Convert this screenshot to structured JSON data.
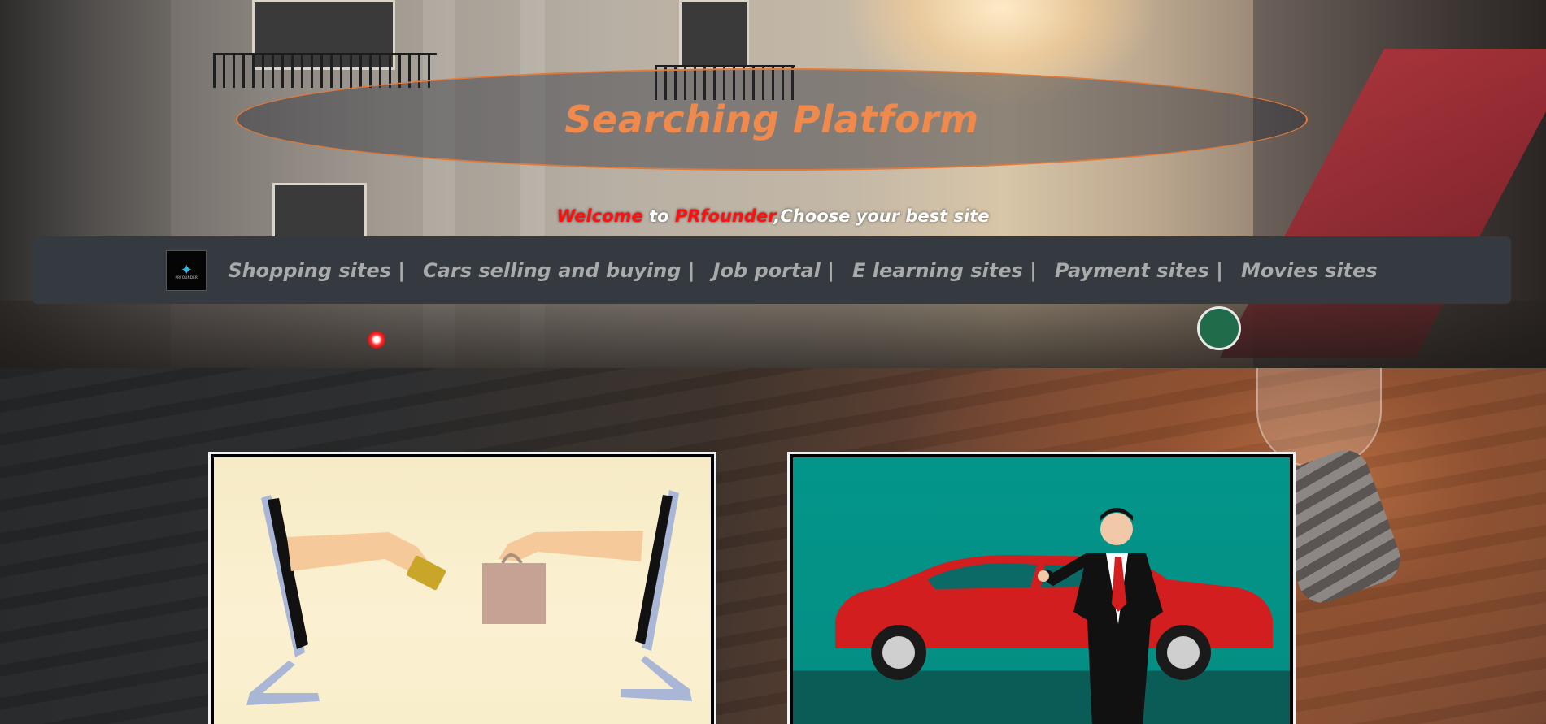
{
  "header": {
    "title": "Searching Platform",
    "welcome": {
      "word1": "Welcome",
      "word2": " to ",
      "brand": "PRfounder",
      "rest": ",Choose your best site"
    }
  },
  "nav": {
    "logo_text": "PRFOUNDER",
    "items": [
      "Shopping sites |",
      "Cars selling and buying |",
      "Job portal |",
      "E learning sites |",
      "Payment sites |",
      "Movies sites"
    ]
  },
  "cards": [
    {
      "name": "shopping-card",
      "illustration": "online-shopping-hands-monitors"
    },
    {
      "name": "cars-card",
      "illustration": "businessman-with-red-car"
    }
  ],
  "colors": {
    "title": "#f08a4c",
    "ellipse_border": "#e07a3b",
    "navbar_bg": "#343a40",
    "nav_text": "#a9aaaa",
    "welcome_red": "#ff1010",
    "card_border": "#f2f2f2"
  }
}
